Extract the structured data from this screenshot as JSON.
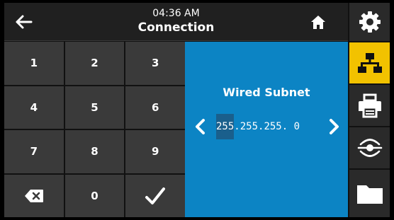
{
  "header": {
    "time": "04:36 AM",
    "title": "Connection"
  },
  "keypad": {
    "keys": [
      "1",
      "2",
      "3",
      "4",
      "5",
      "6",
      "7",
      "8",
      "9",
      "",
      "0",
      ""
    ]
  },
  "editor": {
    "label": "Wired Subnet",
    "value_active": "255",
    "value_rest": ".255.255. 0"
  },
  "sidebar": {
    "items": [
      "gear-icon",
      "network-icon",
      "printer-icon",
      "sensor-icon",
      "folder-icon"
    ],
    "active_index": 1
  },
  "colors": {
    "accent": "#0c84c4",
    "active_tab": "#f2c200",
    "key": "#3a3a3a"
  }
}
